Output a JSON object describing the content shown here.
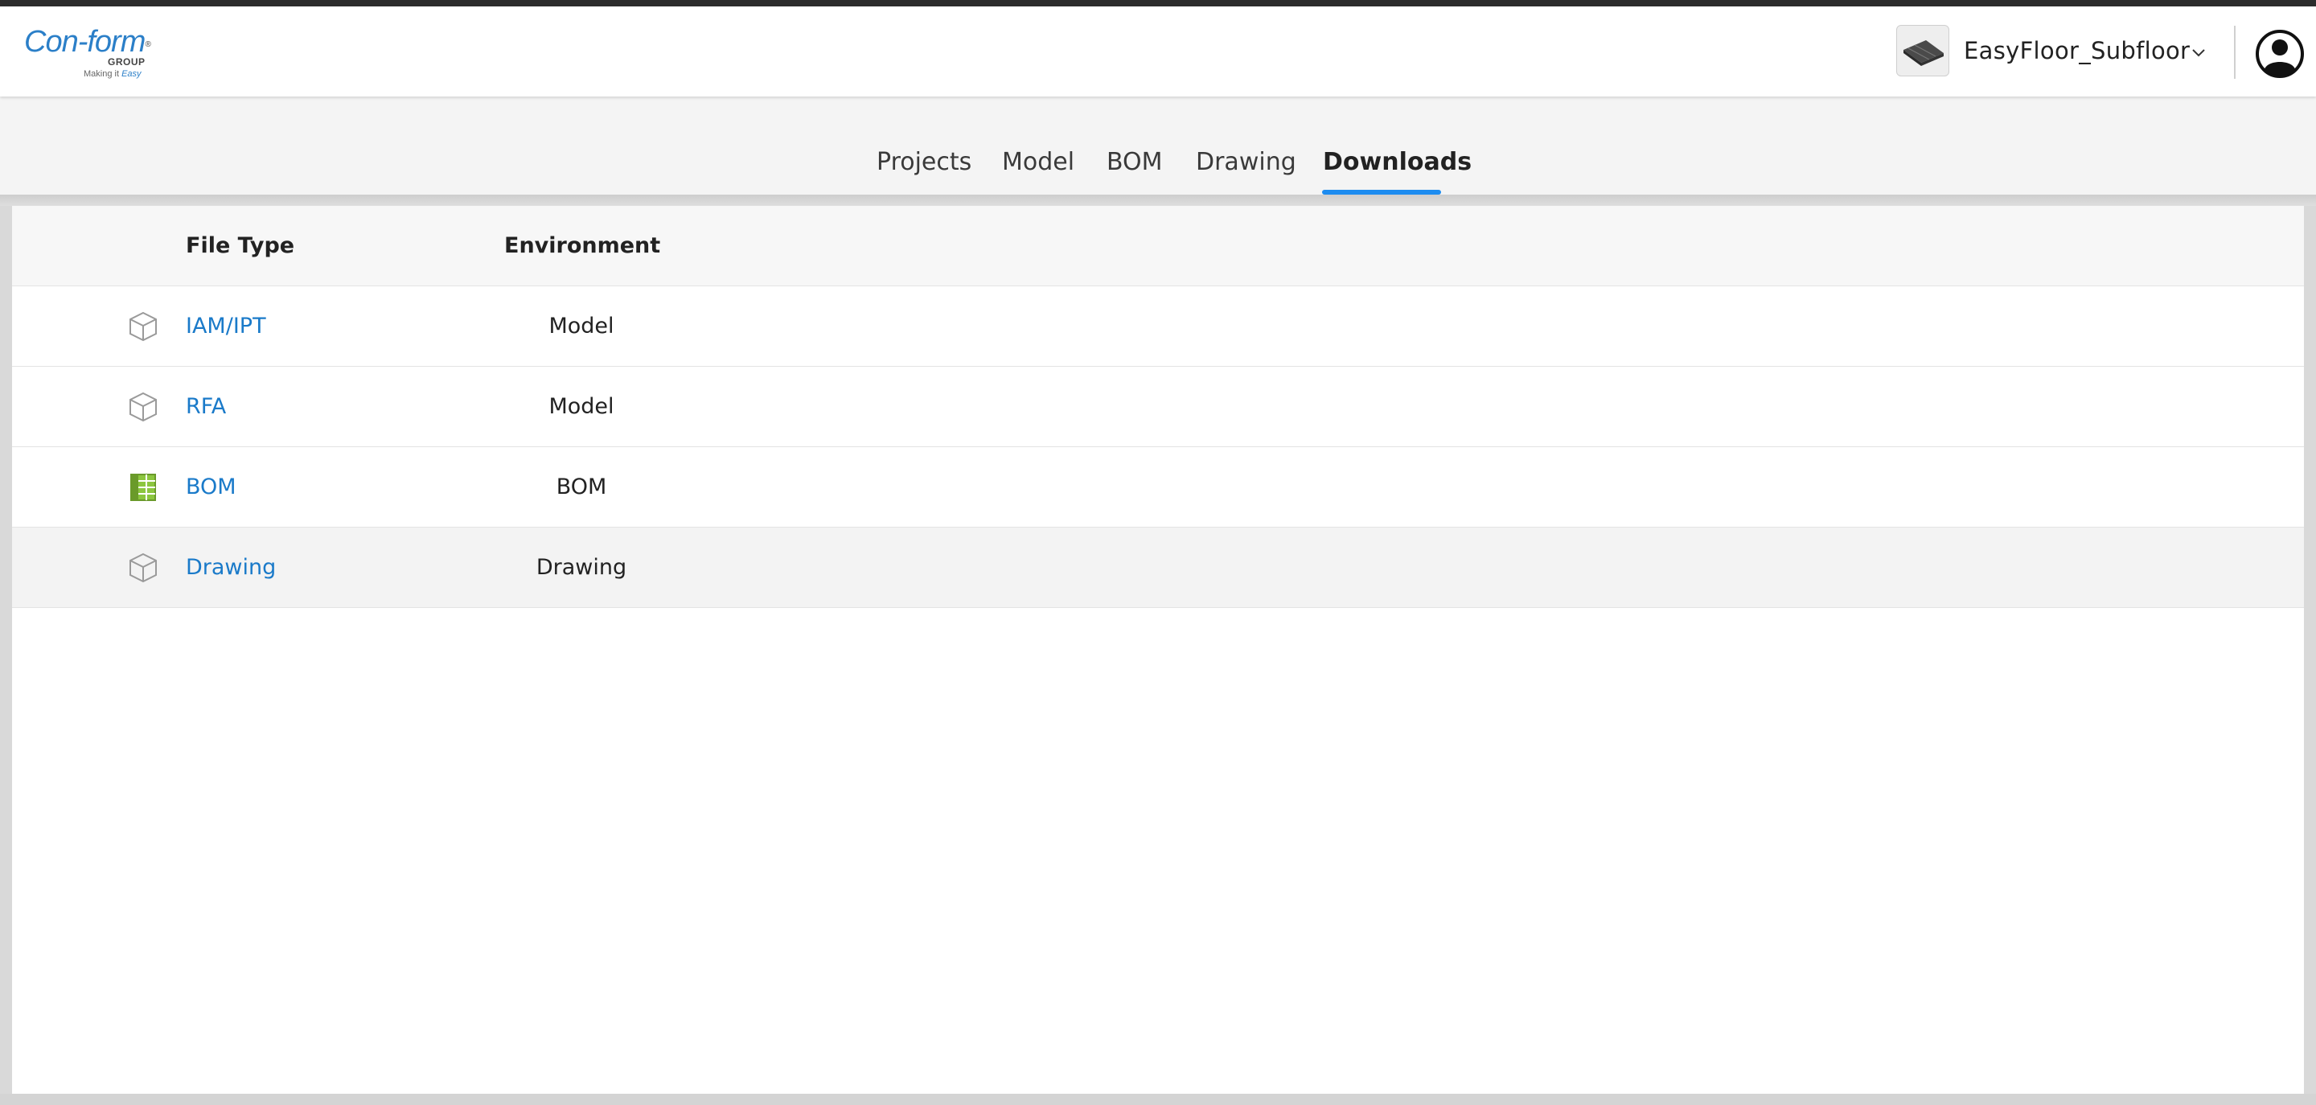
{
  "header": {
    "logo": {
      "brand": "Con-form",
      "group": "GROUP",
      "tagline_prefix": "Making it ",
      "tagline_emphasis": "Easy"
    },
    "product_name": "EasyFloor_Subfloor",
    "product_icon": "subfloor-panel-thumbnail",
    "chevron_icon": "chevron-down-icon",
    "avatar_icon": "user-avatar-icon"
  },
  "tabs": [
    {
      "label": "Projects",
      "active": false
    },
    {
      "label": "Model",
      "active": false
    },
    {
      "label": "BOM",
      "active": false
    },
    {
      "label": "Drawing",
      "active": false
    },
    {
      "label": "Downloads",
      "active": true
    }
  ],
  "table": {
    "columns": {
      "file_type": "File Type",
      "environment": "Environment"
    },
    "rows": [
      {
        "icon": "cube-icon",
        "file_type": "IAM/IPT",
        "environment": "Model"
      },
      {
        "icon": "cube-icon",
        "file_type": "RFA",
        "environment": "Model"
      },
      {
        "icon": "spreadsheet-icon",
        "file_type": "BOM",
        "environment": "BOM"
      },
      {
        "icon": "cube-icon",
        "file_type": "Drawing",
        "environment": "Drawing"
      }
    ]
  },
  "colors": {
    "accent": "#1d8cf0",
    "link": "#1a7ac9",
    "brand": "#2b7fc8",
    "bom_icon": "#7ab030"
  }
}
